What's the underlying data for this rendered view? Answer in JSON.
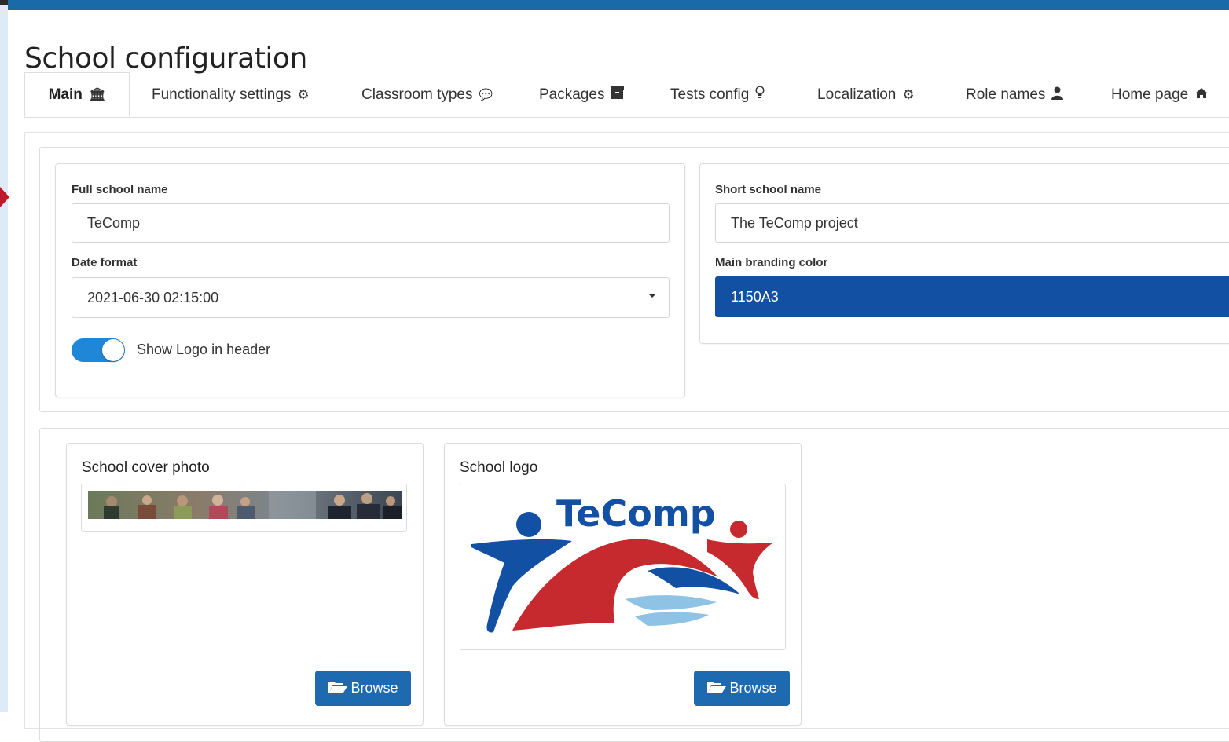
{
  "page": {
    "title": "School configuration"
  },
  "tabs": [
    {
      "label": "Main",
      "icon": "bank-icon",
      "glyph": "🏛"
    },
    {
      "label": "Functionality settings",
      "icon": "cogs-icon",
      "glyph": "⚙"
    },
    {
      "label": "Classroom types",
      "icon": "comment-icon",
      "glyph": "💬"
    },
    {
      "label": "Packages",
      "icon": "archive-icon",
      "glyph": "▀"
    },
    {
      "label": "Tests config",
      "icon": "lightbulb-icon",
      "glyph": "💡"
    },
    {
      "label": "Localization",
      "icon": "cogs-icon",
      "glyph": "⚙"
    },
    {
      "label": "Role names",
      "icon": "user-icon",
      "glyph": "👤"
    },
    {
      "label": "Home page",
      "icon": "home-icon",
      "glyph": "⌂"
    }
  ],
  "main": {
    "full_name": {
      "label": "Full school name",
      "value": "TeComp"
    },
    "date_format": {
      "label": "Date format",
      "value": "2021-06-30 02:15:00"
    },
    "show_logo": {
      "label": "Show Logo in header",
      "on": true
    },
    "short_name": {
      "label": "Short school name",
      "value": "The TeComp project"
    },
    "branding": {
      "label": "Main branding color",
      "value": "1150A3"
    }
  },
  "media": {
    "cover": {
      "title": "School cover photo",
      "browse_label": "Browse"
    },
    "logo": {
      "title": "School logo",
      "logo_text": "TeComp",
      "browse_label": "Browse"
    }
  },
  "colors": {
    "accent": "#1a6aa8",
    "branding": "#1150A3",
    "toggle": "#1f86d8",
    "button": "#1d6ab0",
    "logo_blue": "#1250a3",
    "logo_red": "#c6292e",
    "logo_light": "#8fc3e6"
  }
}
